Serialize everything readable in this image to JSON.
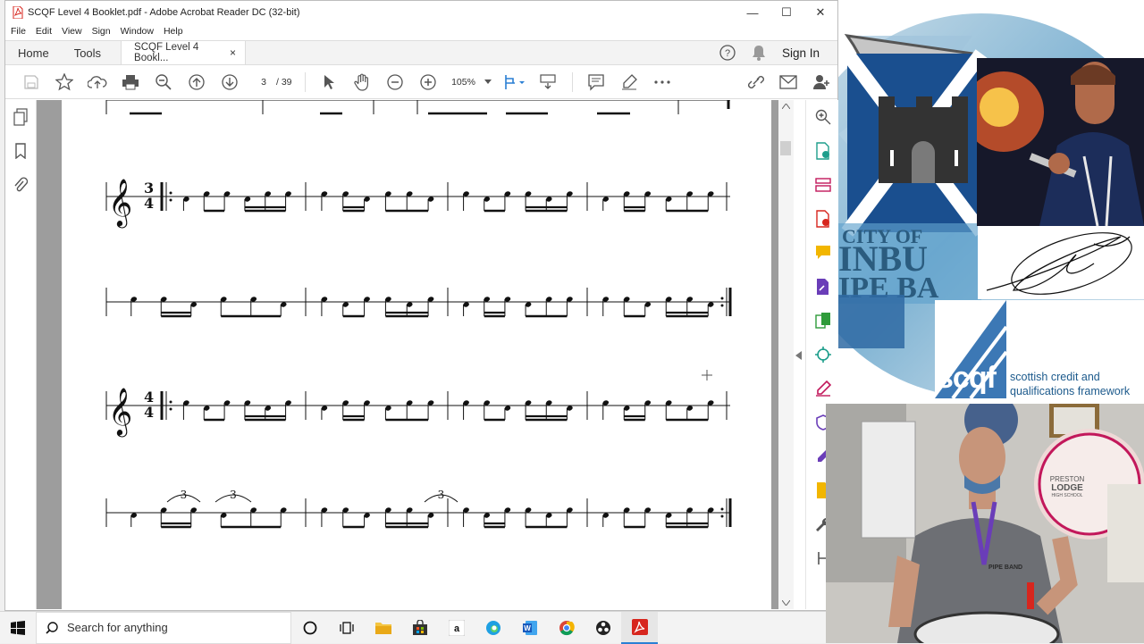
{
  "window": {
    "title": "SCQF Level 4 Booklet.pdf - Adobe Acrobat Reader DC (32-bit)",
    "controls": {
      "minimize": "—",
      "maximize": "☐",
      "close": "✕"
    }
  },
  "menu": [
    "File",
    "Edit",
    "View",
    "Sign",
    "Window",
    "Help"
  ],
  "tabs": {
    "home": "Home",
    "tools": "Tools",
    "document": "SCQF Level 4 Bookl...",
    "document_close": "×",
    "sign_in": "Sign In"
  },
  "toolbar": {
    "current_page": "3",
    "page_separator": "/ 39",
    "zoom": "105%"
  },
  "sheet_music": {
    "row1_time_signature": {
      "top": "3",
      "bottom": "4"
    },
    "row3_time_signature": {
      "top": "4",
      "bottom": "4"
    },
    "triplet_mark": "3"
  },
  "branding": {
    "band_name_line1": "CITY OF",
    "band_name_line2": "INBU",
    "band_name_line3": "IPE BA",
    "scqf_logo": "scqf",
    "scqf_tagline_line1": "scottish credit and",
    "scqf_tagline_line2": "qualifications framework"
  },
  "webcam": {
    "badge_line1": "PRESTON",
    "badge_line2": "LODGE",
    "badge_line3": "HIGH SCHOOL",
    "shirt_text": "PIPE BAND"
  },
  "taskbar": {
    "search_placeholder": "Search for anything"
  },
  "colors": {
    "acrobat_red": "#d7261e",
    "scqf_blue": "#1c5a8c",
    "toolbar_icon": "#555555"
  }
}
